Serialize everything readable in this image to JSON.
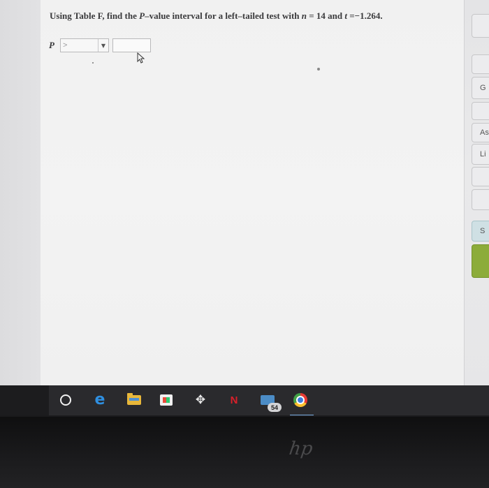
{
  "question": {
    "prefix": "Using Table F, find the ",
    "p_symbol": "P",
    "middle": "–value interval for a left–tailed test with ",
    "n_symbol": "n",
    "n_equals": " = 14 and ",
    "t_symbol": "t",
    "t_equals": " =−1.264."
  },
  "answer": {
    "p_label": "P",
    "dropdown_value": ">",
    "dropdown_arrow": "▼",
    "text_value": ""
  },
  "right_tabs": [
    "",
    "G",
    "",
    "As",
    "Li",
    "",
    "",
    "S",
    ""
  ],
  "taskbar": {
    "mail_badge": "54"
  },
  "bezel": {
    "logo": "hp"
  },
  "icons": [
    "search-icon",
    "edge-icon",
    "file-explorer-icon",
    "store-icon",
    "dropbox-icon",
    "netflix-icon",
    "mail-icon",
    "chrome-icon"
  ]
}
